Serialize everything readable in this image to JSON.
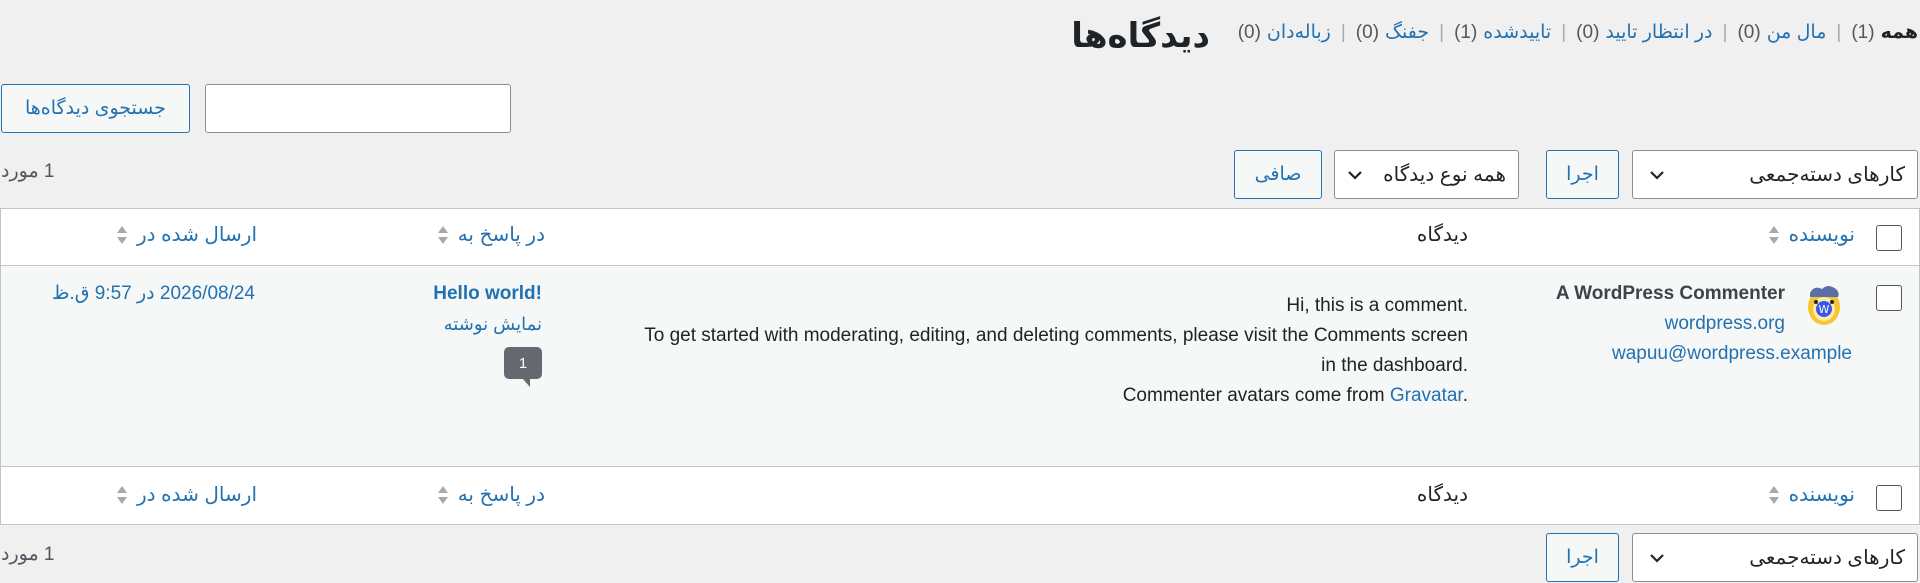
{
  "header": {
    "title": "دیدگاه‌ها"
  },
  "filters_nav": [
    {
      "label": "همه",
      "count": "(1)",
      "current": true
    },
    {
      "label": "مال من",
      "count": "(0)"
    },
    {
      "label": "در انتظار تایید",
      "count": "(0)"
    },
    {
      "label": "تاییدشده",
      "count": "(1)"
    },
    {
      "label": "جفنگ",
      "count": "(0)"
    },
    {
      "label": "زباله‌دان",
      "count": "(0)"
    }
  ],
  "search": {
    "value": "",
    "button_label": "جستجوی دیدگاه‌ها"
  },
  "tablenav_top": {
    "bulk_actions": "کارهای دسته‌جمعی",
    "apply_label": "اجرا",
    "comment_type": "همه نوع دیدگاه",
    "filter_label": "صافی",
    "items_count": "1 مورد"
  },
  "table": {
    "columns": {
      "author": "نویسنده",
      "comment": "دیدگاه",
      "in_response_to": "در پاسخ به",
      "submitted_on": "ارسال شده در"
    },
    "row": {
      "author_name": "A WordPress Commenter",
      "author_url": "wordpress.org",
      "author_email": "wapuu@wordpress.example",
      "comment_line1": "Hi, this is a comment.",
      "comment_line2": "To get started with moderating, editing, and deleting comments, please visit the Comments screen",
      "comment_line3": "in the dashboard.",
      "comment_line4_prefix": "Commenter avatars come from ",
      "comment_line4_link": "Gravatar",
      "comment_line4_suffix": ".",
      "post_title": "Hello world!",
      "view_post": "نمایش نوشته",
      "comment_count": "1",
      "date": "2026/08/24 در 9:57 ق.ظ"
    }
  },
  "tablenav_bottom": {
    "bulk_actions": "کارهای دسته‌جمعی",
    "apply_label": "اجرا",
    "items_count": "1 مورد"
  },
  "colors": {
    "link": "#2271b1",
    "text": "#1d2327",
    "background": "#f0f0f1"
  }
}
